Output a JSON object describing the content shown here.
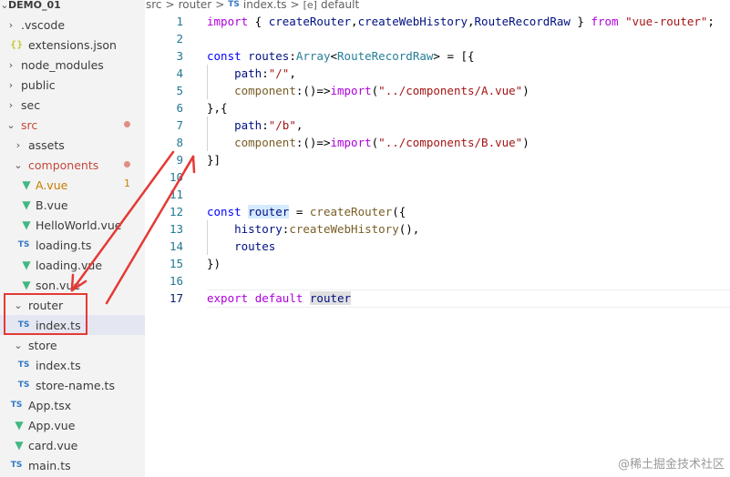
{
  "explorer": {
    "root_label": "DEMO_01",
    "items": [
      {
        "label": ".vscode",
        "kind": "folder",
        "open": false,
        "icon": "chevron-right"
      },
      {
        "label": "extensions.json",
        "kind": "json",
        "icon_text": "{}"
      },
      {
        "label": "node_modules",
        "kind": "folder",
        "open": false
      },
      {
        "label": "public",
        "kind": "folder",
        "open": false
      },
      {
        "label": "sec",
        "kind": "folder",
        "open": false
      },
      {
        "label": "src",
        "kind": "folder",
        "open": true
      },
      {
        "label": "assets",
        "kind": "folder",
        "open": false
      },
      {
        "label": "components",
        "kind": "folder",
        "open": true
      },
      {
        "label": "A.vue",
        "kind": "vue",
        "badge": "1"
      },
      {
        "label": "B.vue",
        "kind": "vue"
      },
      {
        "label": "HelloWorld.vue",
        "kind": "vue"
      },
      {
        "label": "loading.ts",
        "kind": "ts",
        "icon_text": "TS"
      },
      {
        "label": "loading.vue",
        "kind": "vue"
      },
      {
        "label": "son.vue",
        "kind": "vue"
      },
      {
        "label": "router",
        "kind": "folder",
        "open": true
      },
      {
        "label": "index.ts",
        "kind": "ts",
        "icon_text": "TS",
        "selected": true
      },
      {
        "label": "store",
        "kind": "folder",
        "open": true
      },
      {
        "label": "index.ts",
        "kind": "ts",
        "icon_text": "TS"
      },
      {
        "label": "store-name.ts",
        "kind": "ts",
        "icon_text": "TS"
      },
      {
        "label": "App.tsx",
        "kind": "tsx",
        "icon_text": "TS"
      },
      {
        "label": "App.vue",
        "kind": "vue"
      },
      {
        "label": "card.vue",
        "kind": "vue"
      },
      {
        "label": "main.ts",
        "kind": "ts",
        "icon_text": "TS"
      }
    ]
  },
  "breadcrumb": {
    "parts": [
      "src",
      "router",
      "index.ts",
      "default"
    ],
    "separator": ">",
    "ts_icon_text": "TS",
    "symbol_icon_text": "[e]"
  },
  "editor": {
    "line_numbers": [
      "1",
      "2",
      "3",
      "4",
      "5",
      "6",
      "7",
      "8",
      "9",
      "10",
      "11",
      "12",
      "13",
      "14",
      "15",
      "16",
      "17"
    ],
    "current_line": "17"
  },
  "annotations": {
    "highlight_box_color": "#e53935",
    "arrow_color": "#e53935"
  },
  "watermark": "@稀土掘金技术社区",
  "colors": {
    "keyword": "#0000ff",
    "control": "#af00db",
    "string": "#a31515",
    "function": "#795e26",
    "variable": "#001080",
    "type": "#267f99",
    "line_number": "#237893",
    "sidebar_bg": "#f3f3f3"
  }
}
